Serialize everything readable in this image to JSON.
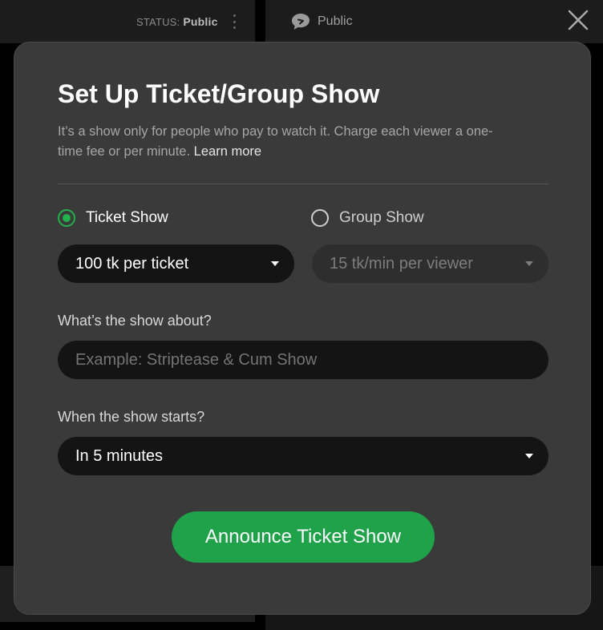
{
  "topbar": {
    "status_label": "STATUS:",
    "status_value": "Public",
    "room_label": "Public"
  },
  "modal": {
    "title": "Set Up Ticket/Group Show",
    "description": "It’s a show only for people who pay to watch it. Charge each viewer a one-time fee or per minute.",
    "learn_more": "Learn more",
    "show_types": [
      {
        "label": "Ticket Show",
        "selected": true
      },
      {
        "label": "Group Show",
        "selected": false
      }
    ],
    "ticket_price": "100 tk per ticket",
    "group_price": "15 tk/min per viewer",
    "about_label": "What’s the show about?",
    "about_placeholder": "Example: Striptease & Cum Show",
    "about_value": "",
    "start_label": "When the show starts?",
    "start_value": "In 5 minutes",
    "cta_label": "Announce Ticket Show"
  },
  "icons": {
    "close": "close-icon",
    "chat": "chat-bubble-icon",
    "more": "more-vertical-icon",
    "caret": "chevron-down-icon"
  },
  "colors": {
    "accent": "#22b14c",
    "button": "#1fa24a",
    "modal_bg": "#3a3a3a",
    "field_bg": "#141414"
  }
}
